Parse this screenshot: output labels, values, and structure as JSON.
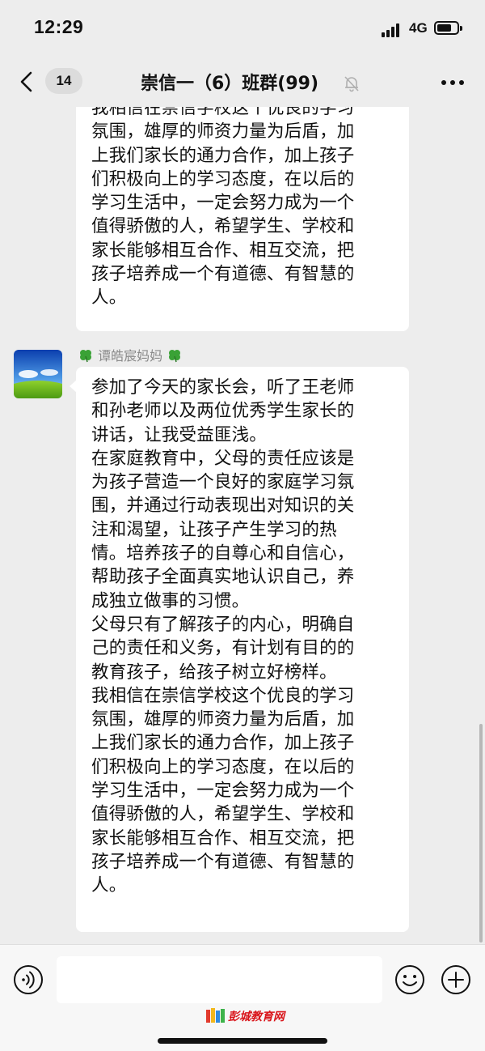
{
  "status_bar": {
    "time": "12:29",
    "network": "4G",
    "icons": [
      "signal-icon",
      "battery-icon"
    ]
  },
  "nav": {
    "back_icon": "chevron-left-icon",
    "unread_count": "14",
    "title": "崇信一（6）班群(99)",
    "mute_icon": "bell-mute-icon",
    "more_icon": "more-dots-icon"
  },
  "messages": [
    {
      "lines": [
        "我相信在崇信学校这个优良的学习",
        "氛围，雄厚的师资力量为后盾，加",
        "上我们家长的通力合作，加上孩子",
        "们积极向上的学习态度，在以后的",
        "学习生活中，一定会努力成为一个",
        "值得骄傲的人，希望学生、学校和",
        "家长能够相互合作、相互交流，把",
        "孩子培养成一个有道德、有智慧的",
        "人。"
      ]
    },
    {
      "sender": "谭皓宸妈妈",
      "sender_icon": "clover-icon",
      "avatar": "sky-landscape-avatar",
      "lines": [
        "参加了今天的家长会，听了王老师",
        "和孙老师以及两位优秀学生家长的",
        "讲话，让我受益匪浅。",
        "在家庭教育中，父母的责任应该是",
        "为孩子营造一个良好的家庭学习氛",
        "围，并通过行动表现出对知识的关",
        "注和渴望，让孩子产生学习的热",
        "情。培养孩子的自尊心和自信心，",
        "帮助孩子全面真实地认识自己，养",
        "成独立做事的习惯。",
        "父母只有了解孩子的内心，明确自",
        "己的责任和义务，有计划有目的的",
        "教育孩子，给孩子树立好榜样。",
        "我相信在崇信学校这个优良的学习",
        "氛围，雄厚的师资力量为后盾，加",
        "上我们家长的通力合作，加上孩子",
        "们积极向上的学习态度，在以后的",
        "学习生活中，一定会努力成为一个",
        "值得骄傲的人，希望学生、学校和",
        "家长能够相互合作、相互交流，把",
        "孩子培养成一个有道德、有智慧的",
        "人。"
      ]
    }
  ],
  "input_bar": {
    "voice_icon": "voice-icon",
    "input_value": "",
    "emoji_icon": "emoji-icon",
    "plus_icon": "plus-icon"
  },
  "watermark": {
    "text": "彭城教育网",
    "icon": "books-logo"
  },
  "colors": {
    "background": "#ededed",
    "bubble": "#ffffff",
    "sender_name": "#8a8a8a",
    "watermark": "#d9141a"
  }
}
